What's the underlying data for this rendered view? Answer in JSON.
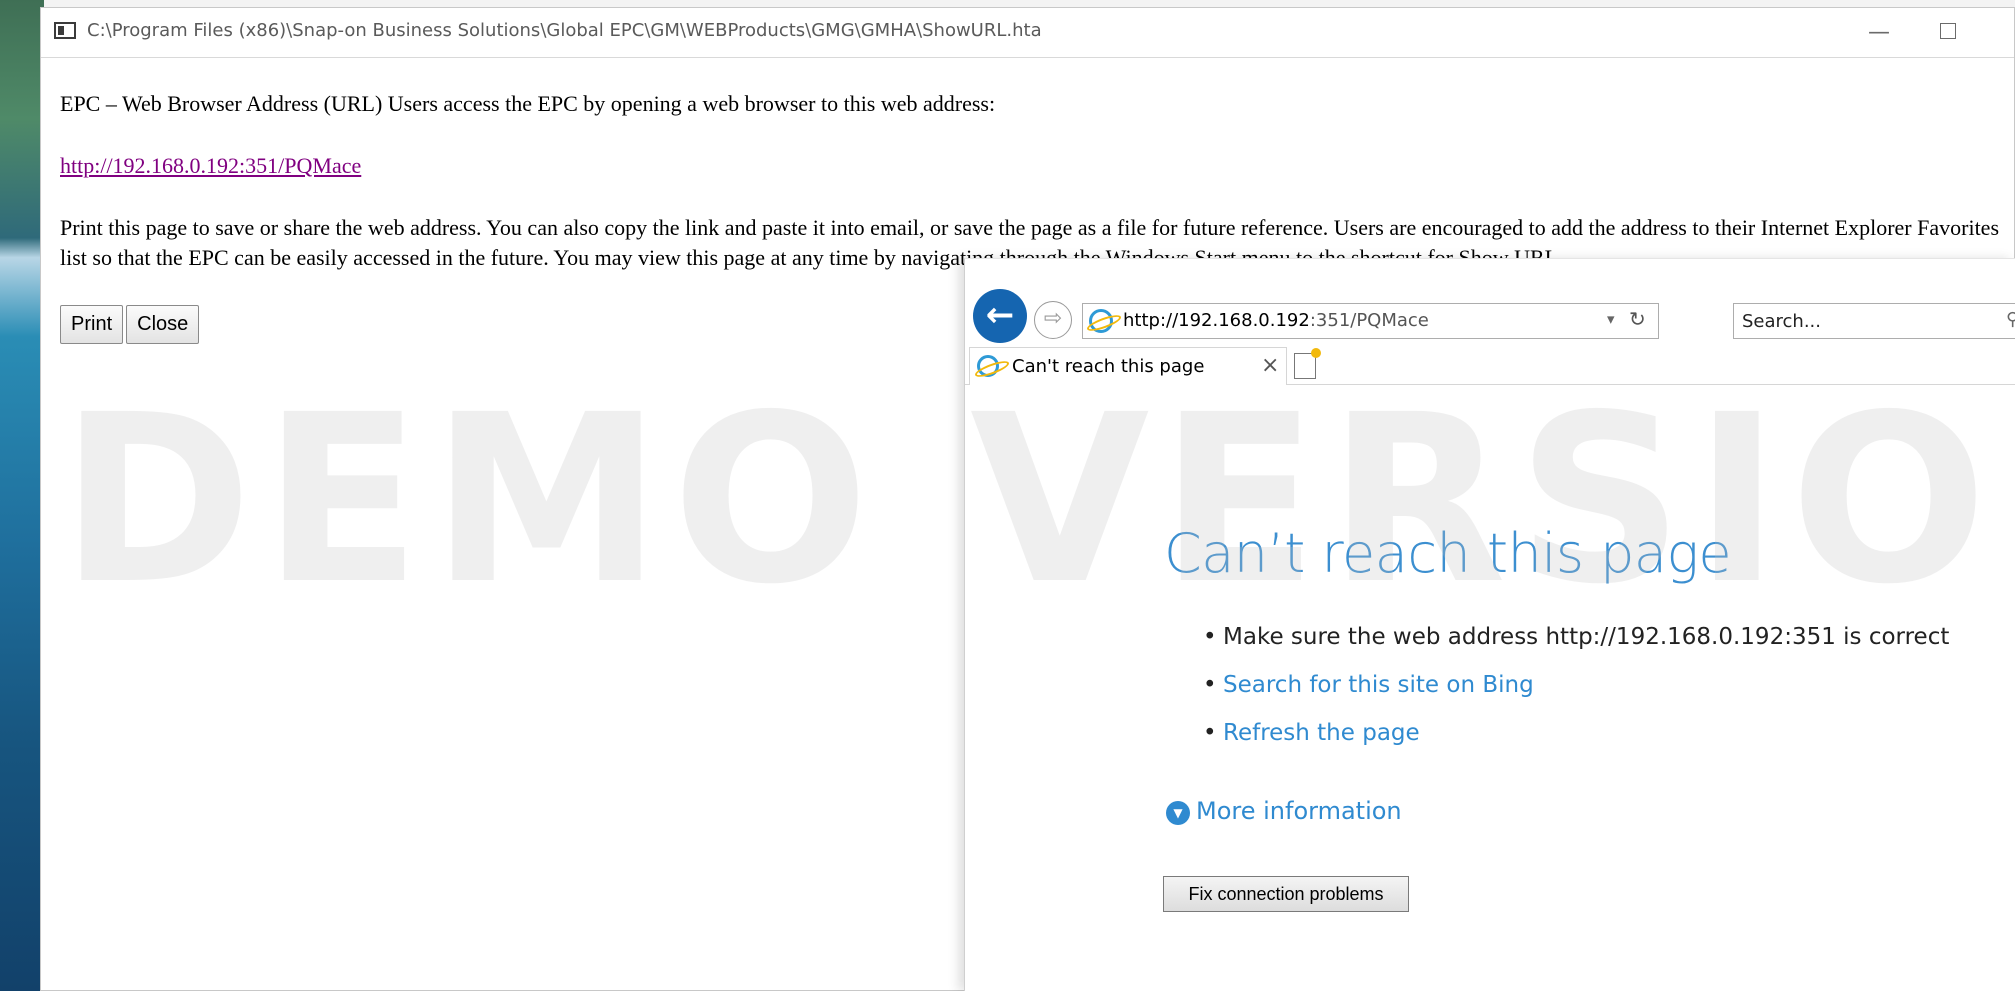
{
  "window": {
    "title": "C:\\Program Files (x86)\\Snap-on Business Solutions\\Global EPC\\GM\\WEBProducts\\GMG\\GMHA\\ShowURL.hta",
    "minimize_glyph": "—"
  },
  "hta": {
    "intro": "EPC – Web Browser Address (URL) Users access the EPC by opening a web browser to this web address:",
    "link": "http://192.168.0.192:351/PQMace",
    "description": "Print this page to save or share the web address. You can also copy the link and paste it into email, or save the page as a file for future reference. Users are encouraged to add the address to their Internet Explorer Favorites list so that the EPC can be easily accessed in the future. You may view this page at any time by navigating through the Windows Start menu to the shortcut for Show URL.",
    "buttons": {
      "print": "Print",
      "close": "Close"
    }
  },
  "watermark": "DEMO VERSION",
  "browser": {
    "address_host": "http://192.168.0.192",
    "address_rest": ":351/PQMace",
    "search_placeholder": "Search...",
    "tab_label": "Can't reach this page",
    "error": {
      "title": "Can’t reach this page",
      "items": [
        {
          "text": "Make sure the web address http://192.168.0.192:351 is correct",
          "link": false
        },
        {
          "text": "Search for this site on Bing",
          "link": true
        },
        {
          "text": "Refresh the page",
          "link": true
        }
      ],
      "more_info": "More information",
      "fix_button": "Fix connection problems"
    },
    "colors": {
      "back_button": "#1565b0",
      "link_blue": "#2f8ad0",
      "title_blue": "#3c8fd0"
    }
  }
}
